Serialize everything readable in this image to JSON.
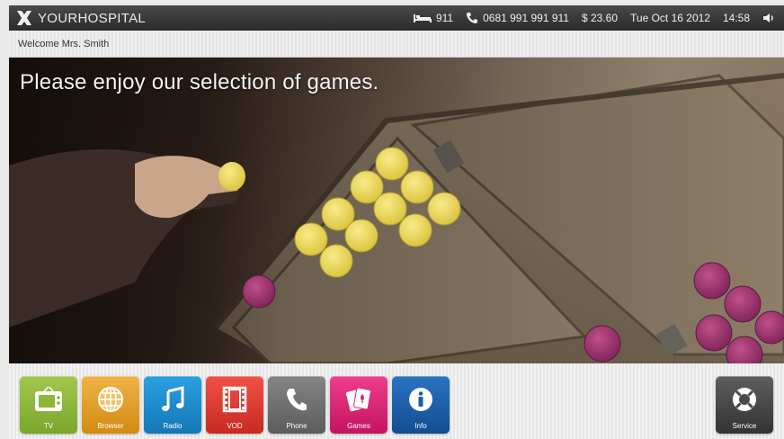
{
  "topbar": {
    "brand_prefix": "YOUR",
    "brand_suffix": "HOSPITAL",
    "room_number": "911",
    "phone_number": "0681 991 991 911",
    "balance": "$ 23.60",
    "date": "Tue Oct 16 2012",
    "time": "14:58",
    "icons": {
      "room": "bed-icon",
      "phone": "phone-icon",
      "volume": "speaker-icon"
    }
  },
  "welcome": {
    "text": "Welcome Mrs. Smith"
  },
  "hero": {
    "title": "Please enjoy our selection of games."
  },
  "dock": {
    "apps": [
      {
        "label": "TV",
        "icon": "tv-icon",
        "color": "#8db63a"
      },
      {
        "label": "Browser",
        "icon": "globe-icon",
        "color": "#e8a021"
      },
      {
        "label": "Radio",
        "icon": "music-note-icon",
        "color": "#1b8fd1"
      },
      {
        "label": "VOD",
        "icon": "film-icon",
        "color": "#e03a2e"
      },
      {
        "label": "Phone",
        "icon": "phone-handset-icon",
        "color": "#6f6f6f"
      },
      {
        "label": "Games",
        "icon": "playing-cards-icon",
        "color": "#e2237a"
      },
      {
        "label": "Info",
        "icon": "info-icon",
        "color": "#1a5ea8"
      }
    ],
    "service": {
      "label": "Service",
      "icon": "lifebuoy-icon",
      "color": "#4a4a4a"
    }
  }
}
